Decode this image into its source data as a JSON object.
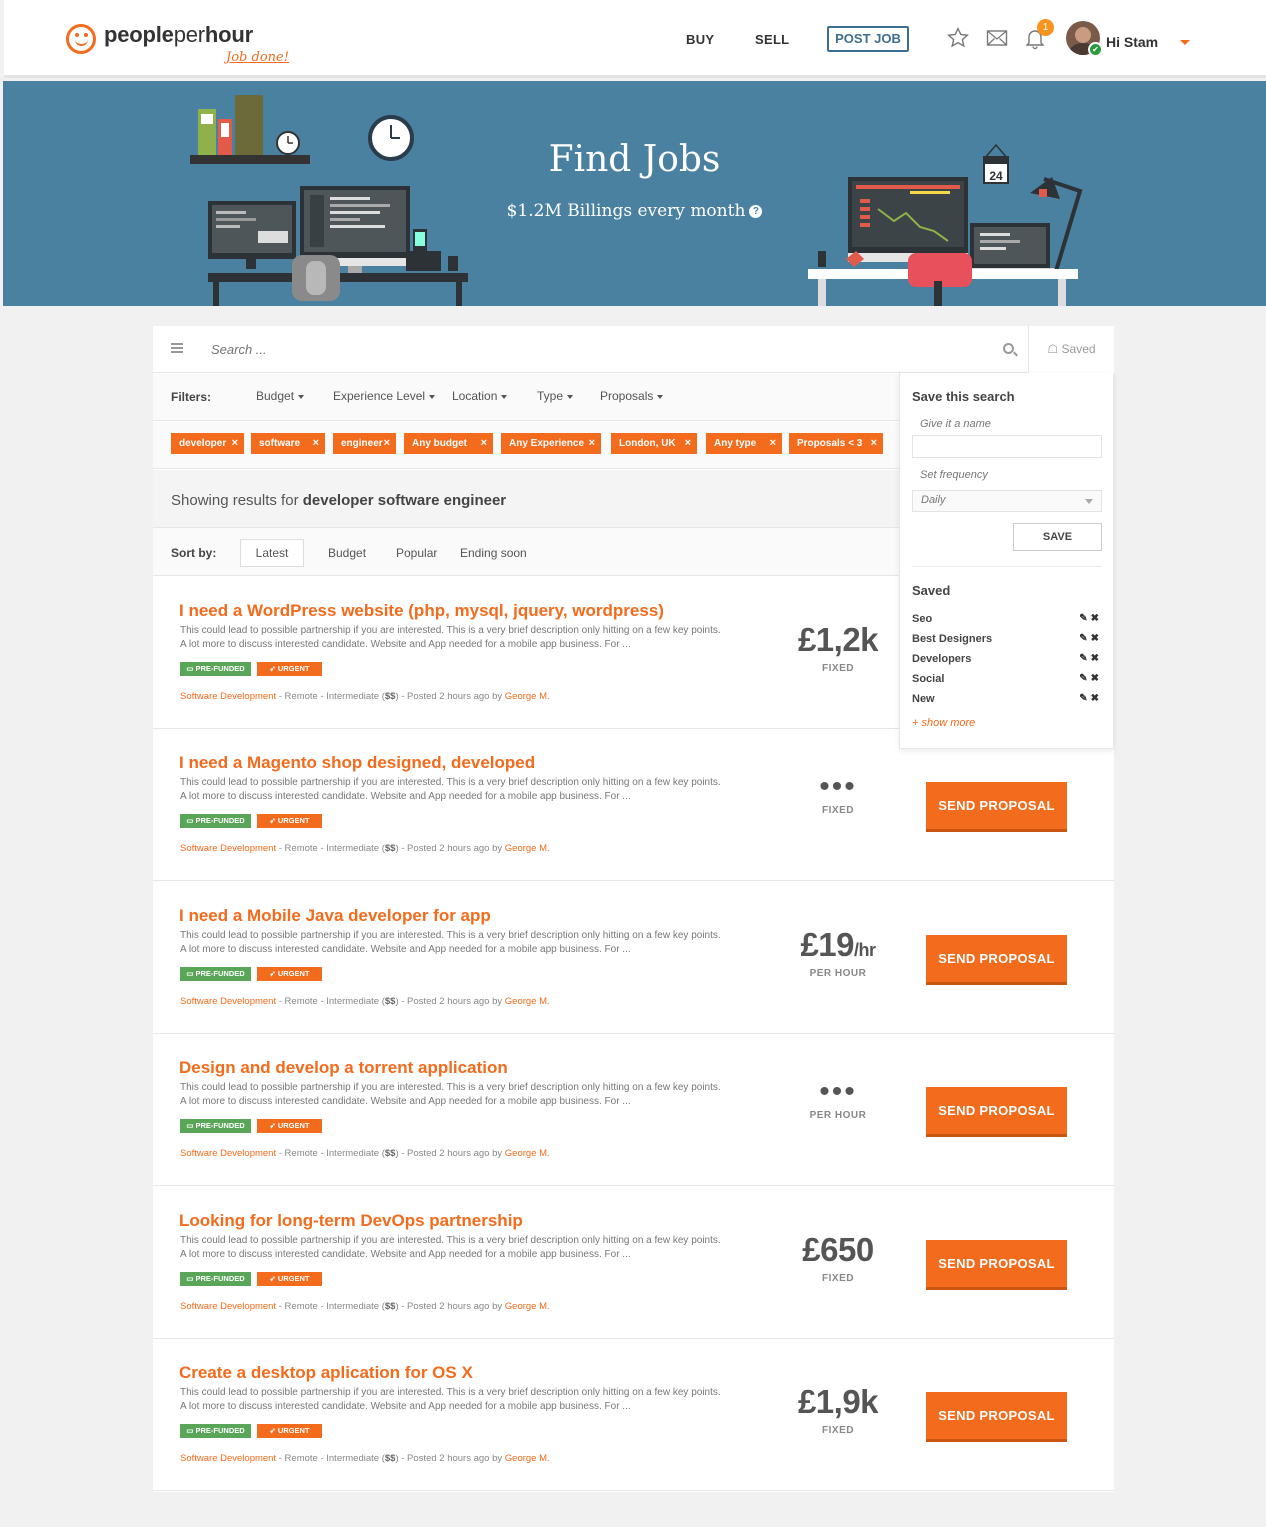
{
  "header": {
    "logo_text_a": "people",
    "logo_text_b": "per",
    "logo_text_c": "hour",
    "logo_tagline": "Job done!",
    "nav": {
      "buy": "BUY",
      "sell": "SELL",
      "post_job": "POST JOB"
    },
    "notification_count": "1",
    "user_greeting": "Hi Stam"
  },
  "hero": {
    "title": "Find Jobs",
    "subtitle": "$1.2M Billings every month",
    "calendar_day": "24",
    "background_color": "#4a80a0"
  },
  "search": {
    "placeholder": "Search ...",
    "saved_tab": "Saved"
  },
  "filters": {
    "label": "Filters:",
    "dropdowns": [
      "Budget",
      "Experience Level",
      "Location",
      "Type",
      "Proposals"
    ],
    "tags": [
      "developer",
      "software",
      "engineer",
      "Any budget",
      "Any Experience",
      "London, UK",
      "Any type",
      "Proposals < 3"
    ]
  },
  "results": {
    "prefix": "Showing results for",
    "query": "developer software engineer"
  },
  "sort": {
    "label": "Sort by:",
    "options": [
      "Latest",
      "Budget",
      "Popular",
      "Ending soon"
    ],
    "active": "Latest"
  },
  "jobs": [
    {
      "title": "I need a WordPress website (php, mysql, jquery, wordpress)",
      "description": "This could lead to possible partnership if you are interested. This is a very brief description only hitting on a few key points. A lot more to discuss interested candidate. Website and App needed for a mobile app business. For ...",
      "badge_funded": "PRE-FUNDED",
      "badge_urgent": "URGENT",
      "category": "Software Development",
      "meta_a": " - Remote - Intermediate (",
      "level": "$$",
      "meta_b": ") - Posted 2 hours ago by ",
      "author": "George M.",
      "price": "£1,2k",
      "price_unit": "",
      "price_kind": "FIXED",
      "button": ""
    },
    {
      "title": "I need a Magento shop designed, developed",
      "description": "This could lead to possible partnership if you are interested. This is a very brief description only hitting on a few key points. A lot more to discuss interested candidate. Website and App needed for a mobile app business. For ...",
      "badge_funded": "PRE-FUNDED",
      "badge_urgent": "URGENT",
      "category": "Software Development",
      "meta_a": " - Remote - Intermediate (",
      "level": "$$",
      "meta_b": ") - Posted 2 hours ago by ",
      "author": "George M.",
      "price": "•••",
      "price_unit": "",
      "price_kind": "FIXED",
      "button": "SEND PROPOSAL"
    },
    {
      "title": "I need a Mobile Java developer for app",
      "description": "This could lead to possible partnership if you are interested. This is a very brief description only hitting on a few key points. A lot more to discuss interested candidate. Website and App needed for a mobile app business. For ...",
      "badge_funded": "PRE-FUNDED",
      "badge_urgent": "URGENT",
      "category": "Software Development",
      "meta_a": " - Remote - Intermediate (",
      "level": "$$",
      "meta_b": ") - Posted 2 hours ago by ",
      "author": "George M.",
      "price": "£19",
      "price_unit": "/hr",
      "price_kind": "PER HOUR",
      "button": "SEND PROPOSAL"
    },
    {
      "title": "Design and develop a torrent application",
      "description": "This could lead to possible partnership if you are interested. This is a very brief description only hitting on a few key points. A lot more to discuss interested candidate. Website and App needed for a mobile app business. For ...",
      "badge_funded": "PRE-FUNDED",
      "badge_urgent": "URGENT",
      "category": "Software Development",
      "meta_a": " - Remote - Intermediate (",
      "level": "$$",
      "meta_b": ") - Posted 2 hours ago by ",
      "author": "George M.",
      "price": "•••",
      "price_unit": "",
      "price_kind": "PER HOUR",
      "button": "SEND PROPOSAL"
    },
    {
      "title": "Looking for long-term DevOps partnership",
      "description": "This could lead to possible partnership if you are interested. This is a very brief description only hitting on a few key points. A lot more to discuss interested candidate. Website and App needed for a mobile app business. For ...",
      "badge_funded": "PRE-FUNDED",
      "badge_urgent": "URGENT",
      "category": "Software Development",
      "meta_a": " - Remote - Intermediate (",
      "level": "$$",
      "meta_b": ") - Posted 2 hours ago by ",
      "author": "George M.",
      "price": "£650",
      "price_unit": "",
      "price_kind": "FIXED",
      "button": "SEND PROPOSAL"
    },
    {
      "title": "Create a desktop aplication for OS X",
      "description": "This could lead to possible partnership if you are interested. This is a very brief description only hitting on a few key points. A lot more to discuss interested candidate. Website and App needed for a mobile app business. For ...",
      "badge_funded": "PRE-FUNDED",
      "badge_urgent": "URGENT",
      "category": "Software Development",
      "meta_a": " - Remote - Intermediate (",
      "level": "$$",
      "meta_b": ") - Posted 2 hours ago by ",
      "author": "George M.",
      "price": "£1,9k",
      "price_unit": "",
      "price_kind": "FIXED",
      "button": "SEND PROPOSAL"
    }
  ],
  "save_search": {
    "title": "Save this search",
    "name_label": "Give it a name",
    "name_value": "",
    "frequency_label": "Set frequency",
    "frequency_value": "Daily",
    "save_button": "SAVE",
    "saved_title": "Saved",
    "saved_items": [
      "Seo",
      "Best Designers",
      "Developers",
      "Social",
      "New"
    ],
    "show_more": "+ show more"
  },
  "colors": {
    "accent": "#f36b1c",
    "brand_blue": "#3e6f90",
    "funded_green": "#5aa658"
  }
}
